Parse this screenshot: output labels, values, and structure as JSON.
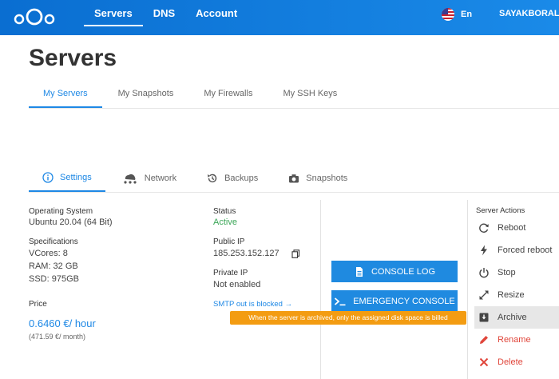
{
  "topbar": {
    "nav": [
      "Servers",
      "DNS",
      "Account"
    ],
    "active_nav": "Servers",
    "lang": "En",
    "user": "SAYAKBORAL@"
  },
  "page": {
    "title": "Servers"
  },
  "subtabs": [
    "My Servers",
    "My Snapshots",
    "My Firewalls",
    "My SSH Keys"
  ],
  "server_tabs": [
    {
      "label": "Settings",
      "icon": "info-icon"
    },
    {
      "label": "Network",
      "icon": "network-icon"
    },
    {
      "label": "Backups",
      "icon": "backup-icon"
    },
    {
      "label": "Snapshots",
      "icon": "camera-icon"
    }
  ],
  "details": {
    "os_label": "Operating System",
    "os_value": "Ubuntu 20.04 (64 Bit)",
    "spec_label": "Specifications",
    "vcores": "VCores: 8",
    "ram": "RAM: 32 GB",
    "ssd": "SSD: 975GB",
    "price_label": "Price",
    "price_hour": "0.6460 €/ hour",
    "price_month": "(471.59 €/ month)",
    "status_label": "Status",
    "status_value": "Active",
    "public_ip_label": "Public IP",
    "public_ip": "185.253.152.127",
    "private_ip_label": "Private IP",
    "private_ip": "Not enabled",
    "smtp_link": "SMTP out is blocked →"
  },
  "buttons": {
    "console_log": "CONSOLE LOG",
    "emergency_console": "EMERGENCY CONSOLE"
  },
  "tooltip": "When the server is archived, only the assigned disk space is billed",
  "actions": {
    "title": "Server Actions",
    "items": [
      {
        "label": "Reboot",
        "icon": "reboot-icon"
      },
      {
        "label": "Forced reboot",
        "icon": "bolt-icon"
      },
      {
        "label": "Stop",
        "icon": "power-icon"
      },
      {
        "label": "Resize",
        "icon": "resize-icon"
      },
      {
        "label": "Archive",
        "icon": "archive-icon"
      },
      {
        "label": "Rename",
        "icon": "pencil-icon"
      },
      {
        "label": "Delete",
        "icon": "delete-icon"
      }
    ]
  },
  "colors": {
    "primary": "#1e88e5",
    "active_status": "#3aa657",
    "tooltip": "#f39c12",
    "danger": "#e0453a"
  }
}
